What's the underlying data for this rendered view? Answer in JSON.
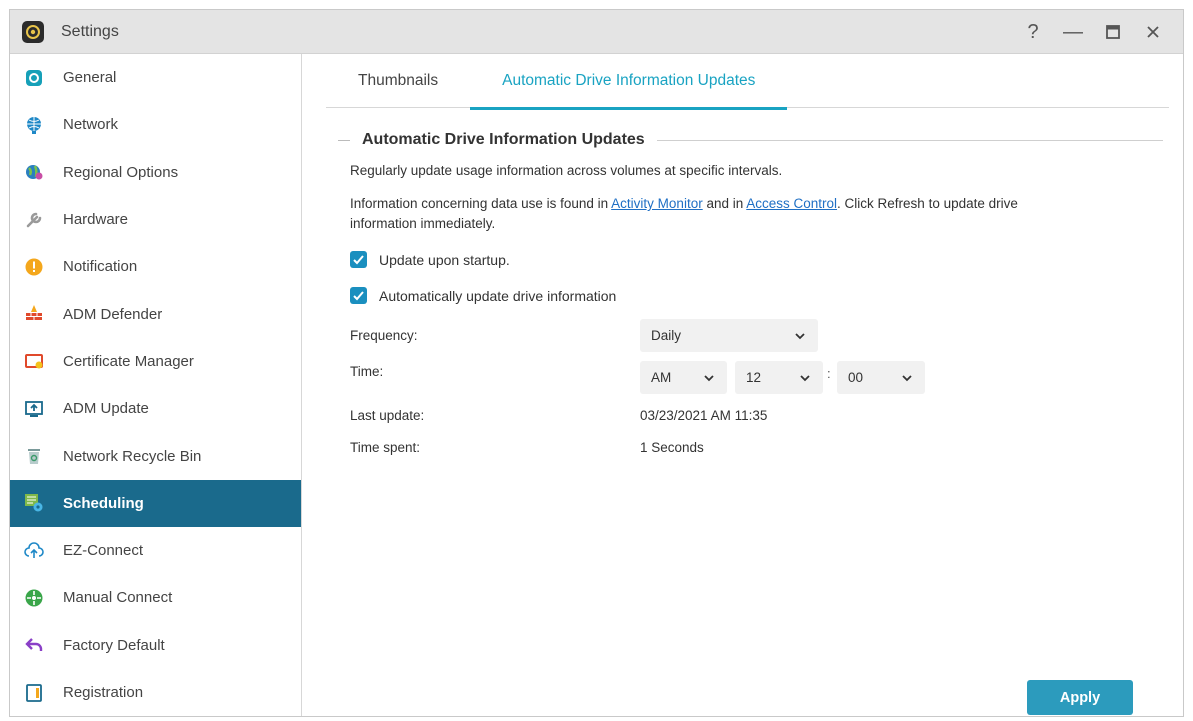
{
  "window": {
    "title": "Settings",
    "controls": {
      "help": "?",
      "minimize": "—"
    }
  },
  "sidebar": {
    "items": [
      {
        "label": "General",
        "icon": "general-icon"
      },
      {
        "label": "Network",
        "icon": "globe-icon"
      },
      {
        "label": "Regional Options",
        "icon": "regional-globe-icon"
      },
      {
        "label": "Hardware",
        "icon": "hardware-wrench-icon"
      },
      {
        "label": "Notification",
        "icon": "notification-alert-icon"
      },
      {
        "label": "ADM Defender",
        "icon": "firewall-icon"
      },
      {
        "label": "Certificate Manager",
        "icon": "certificate-icon"
      },
      {
        "label": "ADM Update",
        "icon": "update-monitor-icon"
      },
      {
        "label": "Network Recycle Bin",
        "icon": "recycle-bin-icon"
      },
      {
        "label": "Scheduling",
        "icon": "scheduling-gear-icon",
        "active": true
      },
      {
        "label": "EZ-Connect",
        "icon": "cloud-upload-icon"
      },
      {
        "label": "Manual Connect",
        "icon": "manual-connect-icon"
      },
      {
        "label": "Factory Default",
        "icon": "factory-reset-arrow-icon"
      },
      {
        "label": "Registration",
        "icon": "registration-icon"
      }
    ]
  },
  "tabs": [
    {
      "label": "Thumbnails",
      "active": false
    },
    {
      "label": "Automatic Drive Information Updates",
      "active": true
    }
  ],
  "section": {
    "title": "Automatic Drive Information Updates",
    "description": "Regularly update usage information across volumes at specific intervals.",
    "info_prefix": "Information concerning data use is found in ",
    "link_activity_monitor": "Activity Monitor",
    "info_middle": " and in ",
    "link_access_control": "Access Control",
    "info_suffix": ". Click Refresh to update drive",
    "info_line2": "information immediately."
  },
  "options": {
    "update_on_startup": {
      "label": "Update upon startup.",
      "checked": true
    },
    "auto_update": {
      "label": "Automatically update drive information",
      "checked": true
    }
  },
  "fields": {
    "frequency_label": "Frequency:",
    "frequency_value": "Daily",
    "time_label": "Time:",
    "time_ampm": "AM",
    "time_hour": "12",
    "time_separator": ":",
    "time_minute": "00",
    "last_update_label": "Last update:",
    "last_update_value": "03/23/2021 AM 11:35",
    "time_spent_label": "Time spent:",
    "time_spent_value": "1 Seconds"
  },
  "footer": {
    "apply_label": "Apply"
  },
  "colors": {
    "accent": "#19a3c2",
    "sidebar_active": "#1a6a8c",
    "checkbox": "#1a8fbf",
    "apply_button": "#2c9bbd",
    "link": "#1f6fc4"
  }
}
